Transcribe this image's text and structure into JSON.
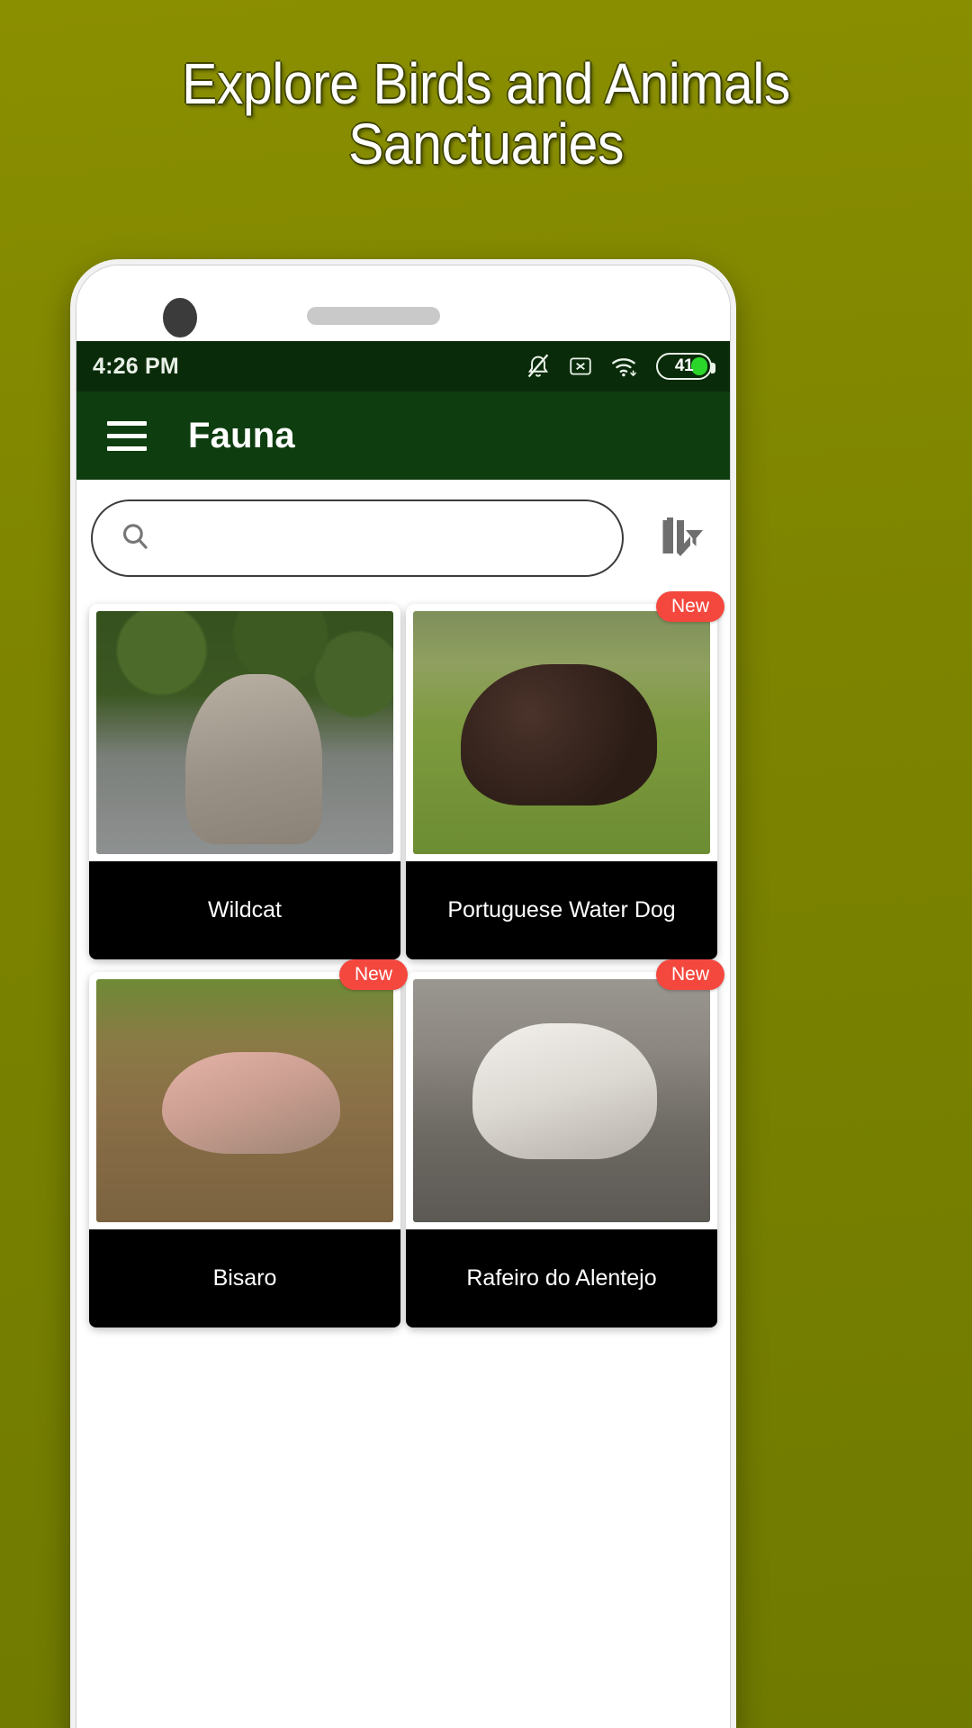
{
  "promo": {
    "headline_line1": "Explore Birds and Animals",
    "headline_line2": "Sanctuaries"
  },
  "colors": {
    "page_background": "#7d8400",
    "statusbar_background": "#0a2b09",
    "appbar_background": "#0e3d10",
    "badge_new": "#f4483f",
    "battery_fill": "#2bd62b",
    "caption_background": "#000000"
  },
  "statusbar": {
    "time": "4:26 PM",
    "battery_level": "41",
    "icons": [
      "bell-off-icon",
      "sim-x-icon",
      "wifi-icon",
      "battery-icon"
    ]
  },
  "appbar": {
    "menu_icon": "hamburger-menu-icon",
    "title": "Fauna"
  },
  "search": {
    "icon": "search-icon",
    "value": "",
    "placeholder": "",
    "sort_icon": "sort-filter-icon"
  },
  "grid": {
    "cards": [
      {
        "name": "Wildcat",
        "badge": "",
        "photo": "wildcat-photo",
        "art_class": "ph-wildcat"
      },
      {
        "name": "Portuguese Water Dog",
        "badge": "New",
        "photo": "portuguese-water-dog-photo",
        "art_class": "ph-waterdog"
      },
      {
        "name": "Bisaro",
        "badge": "New",
        "photo": "bisaro-photo",
        "art_class": "ph-bisaro"
      },
      {
        "name": "Rafeiro do Alentejo",
        "badge": "New",
        "photo": "rafeiro-do-alentejo-photo",
        "art_class": "ph-rafeiro"
      }
    ]
  }
}
